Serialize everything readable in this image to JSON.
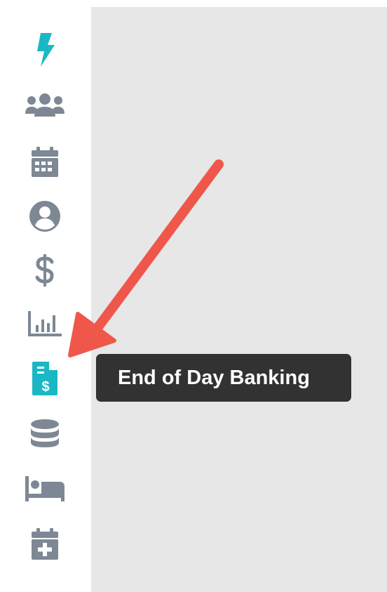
{
  "sidebar": {
    "items": [
      {
        "name": "lightning-icon",
        "active": true
      },
      {
        "name": "users-group-icon",
        "active": false
      },
      {
        "name": "calendar-icon",
        "active": false
      },
      {
        "name": "user-circle-icon",
        "active": false
      },
      {
        "name": "dollar-icon",
        "active": false
      },
      {
        "name": "bar-chart-icon",
        "active": false
      },
      {
        "name": "banking-document-icon",
        "active": true
      },
      {
        "name": "database-icon",
        "active": false
      },
      {
        "name": "bed-icon",
        "active": false
      },
      {
        "name": "calendar-plus-icon",
        "active": false
      }
    ]
  },
  "tooltip": {
    "text": "End of Day Banking"
  },
  "annotation": {
    "arrow_color": "#f0574b"
  },
  "colors": {
    "active": "#1ab8c4",
    "inactive": "#7d8894",
    "content_bg": "#e7e7e7",
    "tooltip_bg": "#323232"
  }
}
